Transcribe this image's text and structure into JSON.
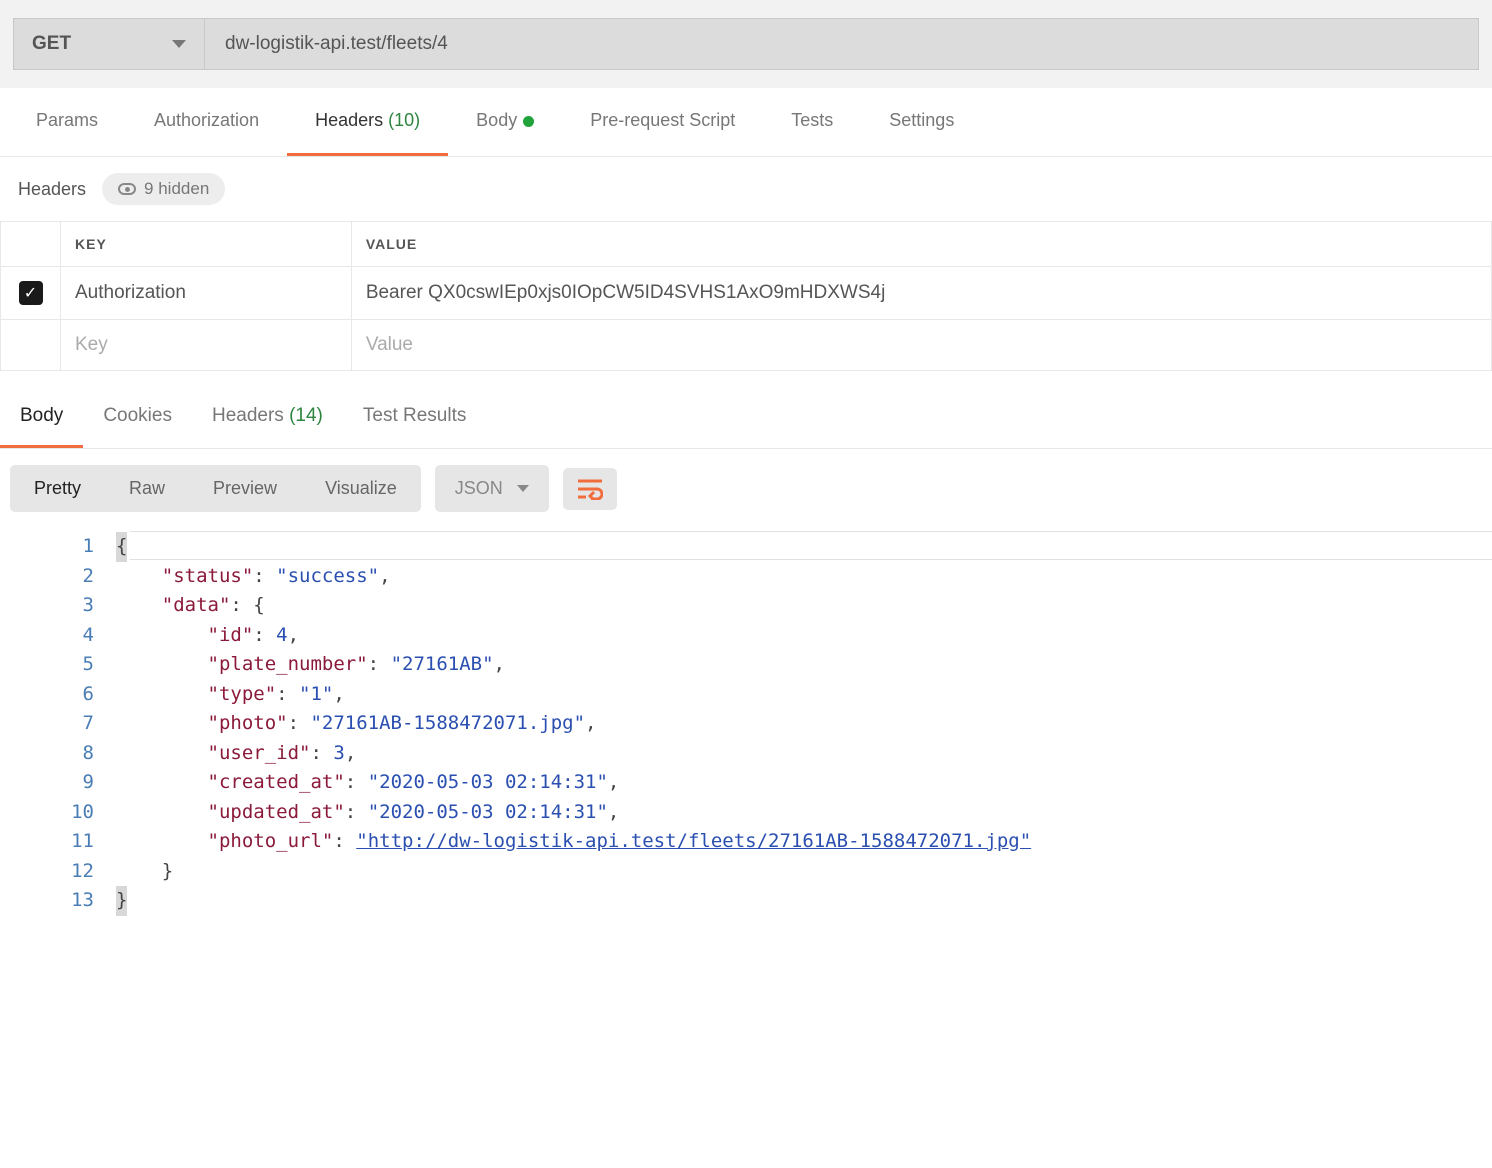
{
  "request": {
    "method": "GET",
    "url": "dw-logistik-api.test/fleets/4"
  },
  "tabs": {
    "params": "Params",
    "authorization": "Authorization",
    "headers_label": "Headers",
    "headers_count": "(10)",
    "body": "Body",
    "prerequest": "Pre-request Script",
    "tests": "Tests",
    "settings": "Settings"
  },
  "headers_section": {
    "title": "Headers",
    "hidden_label": "9 hidden",
    "col_key": "KEY",
    "col_value": "VALUE",
    "rows": [
      {
        "enabled": true,
        "key": "Authorization",
        "value": "Bearer QX0cswIEp0xjs0IOpCW5ID4SVHS1AxO9mHDXWS4j"
      }
    ],
    "placeholder_key": "Key",
    "placeholder_value": "Value"
  },
  "response_tabs": {
    "body": "Body",
    "cookies": "Cookies",
    "headers_label": "Headers",
    "headers_count": "(14)",
    "test_results": "Test Results"
  },
  "response_toolbar": {
    "pretty": "Pretty",
    "raw": "Raw",
    "preview": "Preview",
    "visualize": "Visualize",
    "format": "JSON"
  },
  "response_body": {
    "lines": [
      {
        "n": 1,
        "indent": 0,
        "tokens": [
          {
            "t": "punc_hl",
            "v": "{"
          }
        ]
      },
      {
        "n": 2,
        "indent": 1,
        "tokens": [
          {
            "t": "key",
            "v": "\"status\""
          },
          {
            "t": "punc",
            "v": ": "
          },
          {
            "t": "str",
            "v": "\"success\""
          },
          {
            "t": "punc",
            "v": ","
          }
        ]
      },
      {
        "n": 3,
        "indent": 1,
        "tokens": [
          {
            "t": "key",
            "v": "\"data\""
          },
          {
            "t": "punc",
            "v": ": {"
          }
        ]
      },
      {
        "n": 4,
        "indent": 2,
        "tokens": [
          {
            "t": "key",
            "v": "\"id\""
          },
          {
            "t": "punc",
            "v": ": "
          },
          {
            "t": "num",
            "v": "4"
          },
          {
            "t": "punc",
            "v": ","
          }
        ]
      },
      {
        "n": 5,
        "indent": 2,
        "tokens": [
          {
            "t": "key",
            "v": "\"plate_number\""
          },
          {
            "t": "punc",
            "v": ": "
          },
          {
            "t": "str",
            "v": "\"27161AB\""
          },
          {
            "t": "punc",
            "v": ","
          }
        ]
      },
      {
        "n": 6,
        "indent": 2,
        "tokens": [
          {
            "t": "key",
            "v": "\"type\""
          },
          {
            "t": "punc",
            "v": ": "
          },
          {
            "t": "str",
            "v": "\"1\""
          },
          {
            "t": "punc",
            "v": ","
          }
        ]
      },
      {
        "n": 7,
        "indent": 2,
        "tokens": [
          {
            "t": "key",
            "v": "\"photo\""
          },
          {
            "t": "punc",
            "v": ": "
          },
          {
            "t": "str",
            "v": "\"27161AB-1588472071.jpg\""
          },
          {
            "t": "punc",
            "v": ","
          }
        ]
      },
      {
        "n": 8,
        "indent": 2,
        "tokens": [
          {
            "t": "key",
            "v": "\"user_id\""
          },
          {
            "t": "punc",
            "v": ": "
          },
          {
            "t": "num",
            "v": "3"
          },
          {
            "t": "punc",
            "v": ","
          }
        ]
      },
      {
        "n": 9,
        "indent": 2,
        "tokens": [
          {
            "t": "key",
            "v": "\"created_at\""
          },
          {
            "t": "punc",
            "v": ": "
          },
          {
            "t": "str",
            "v": "\"2020-05-03 02:14:31\""
          },
          {
            "t": "punc",
            "v": ","
          }
        ]
      },
      {
        "n": 10,
        "indent": 2,
        "tokens": [
          {
            "t": "key",
            "v": "\"updated_at\""
          },
          {
            "t": "punc",
            "v": ": "
          },
          {
            "t": "str",
            "v": "\"2020-05-03 02:14:31\""
          },
          {
            "t": "punc",
            "v": ","
          }
        ]
      },
      {
        "n": 11,
        "indent": 2,
        "tokens": [
          {
            "t": "key",
            "v": "\"photo_url\""
          },
          {
            "t": "punc",
            "v": ": "
          },
          {
            "t": "link",
            "v": "\"http://dw-logistik-api.test/fleets/27161AB-1588472071.jpg\""
          }
        ]
      },
      {
        "n": 12,
        "indent": 1,
        "tokens": [
          {
            "t": "punc",
            "v": "}"
          }
        ]
      },
      {
        "n": 13,
        "indent": 0,
        "tokens": [
          {
            "t": "punc_hl",
            "v": "}"
          }
        ]
      }
    ]
  }
}
